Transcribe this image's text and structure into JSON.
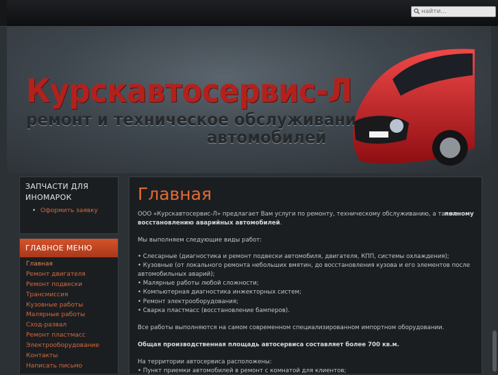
{
  "search": {
    "placeholder": "найти..."
  },
  "header": {
    "brand": "Курскавтосервис-Л",
    "tagline_1": "ремонт и техническое обслуживание",
    "tagline_2": "автомобилей"
  },
  "sidebar": {
    "parts_box": {
      "title_1": "ЗАПЧАСТИ ДЛЯ",
      "title_2": "ИНОМАРОК",
      "link": "Оформить заявку"
    },
    "main_menu": {
      "title": "ГЛАВНОЕ МЕНЮ",
      "items": [
        "Главная",
        "Ремонт двигателя",
        "Ремонт подвески",
        "Трансмиссия",
        "Кузовные работы",
        "Малярные работы",
        "Сход-развал",
        "Ремонт пластмасс",
        "Электрооборудование",
        "Контакты",
        "Написать письмо"
      ]
    }
  },
  "content": {
    "title": "Главная",
    "intro_a": "ООО «Курскавтосервис-Л» предлагает Вам услуги по ремонту, техническому обслуживанию, а также",
    "intro_b": "полному",
    "intro_c": "восстановлению аварийных  автомобилей",
    "intro_d": ".",
    "works_heading": "Мы выполняем следующие виды работ:",
    "works": [
      "• Слесарные (диагностика и ремонт подвески автомобиля, двигателя, КПП, системы охлаждения);",
      "• Кузовные  (от локального ремонта небольших вмятин, до восстановления кузова и его элементов после",
      "автомобильных аварий);",
      "• Малярные работы любой сложности;",
      "• Компьютерная диагностика инжекторных систем;",
      "• Ремонт электрооборудования;",
      "• Сварка пластмасс (восстановление бамперов)."
    ],
    "equipment": "Все работы выполняются на  самом современном специализированном импортном оборудовании.",
    "area": "Общая производственная площадь автосервиса составляет более 700 кв.м.",
    "located_heading": "На территории автосервиса расположены:",
    "located_first": "• Пункт приемки автомобилей в ремонт с комнатой для клиентов;"
  }
}
